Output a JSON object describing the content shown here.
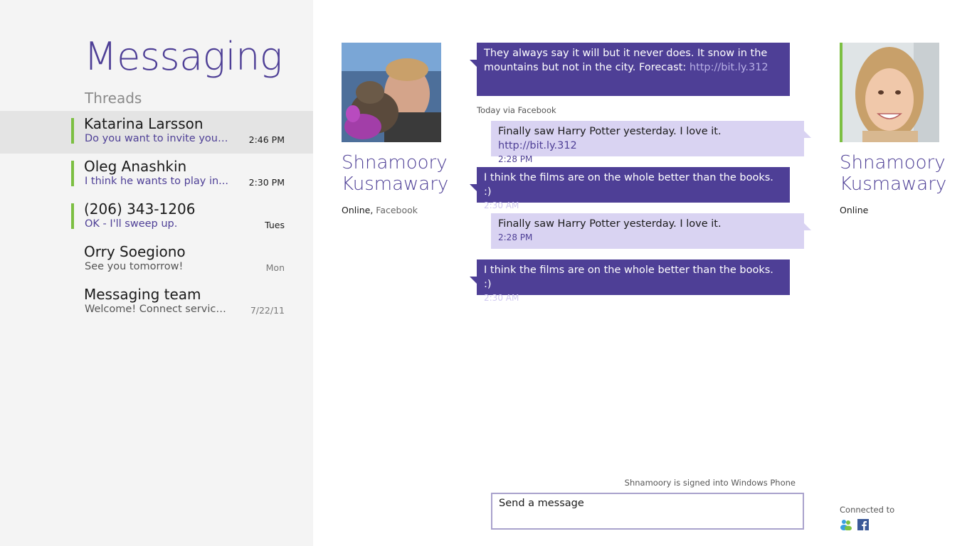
{
  "app": {
    "title": "Messaging",
    "threads_label": "Threads"
  },
  "threads": [
    {
      "name": "Katarina Larsson",
      "preview": "Do you want to invite your f...",
      "time": "2:46 PM"
    },
    {
      "name": "Oleg Anashkin",
      "preview": "I think he wants to play in...",
      "time": "2:30 PM"
    },
    {
      "name": "(206) 343-1206",
      "preview": "OK - I'll sweep up.",
      "time": "Tues"
    },
    {
      "name": "Orry Soegiono",
      "preview": "See you tomorrow!",
      "time": "Mon"
    },
    {
      "name": "Messaging team",
      "preview": "Welcome! Connect services...",
      "time": "7/22/11"
    }
  ],
  "contact_left": {
    "first": "Shnamoory",
    "last": "Kusmawary",
    "status": "Online,",
    "via": "Facebook"
  },
  "contact_right": {
    "first": "Shnamoory",
    "last": "Kusmawary",
    "status": "Online"
  },
  "messages": [
    {
      "text_line1": "They always say it will but it never does.  It snow in the",
      "text_line2": "mountains but not in the city. Forecast: ",
      "link": "http://bit.ly.312"
    },
    {
      "meta": "Today via Facebook"
    },
    {
      "text": "Finally saw Harry Potter yesterday. I love it. ",
      "link": "http://bit.ly.312",
      "time": "2:28 PM"
    },
    {
      "text": "I think the films are on the whole better than the books. :)",
      "time": "2:30 AM"
    },
    {
      "text": "Finally saw Harry Potter yesterday. I love it.",
      "time": "2:28 PM"
    },
    {
      "text": "I think the films are on the whole better than the books. :)",
      "time": "2:30 AM"
    }
  ],
  "composer": {
    "signed_in": "Shnamoory is signed into Windows Phone",
    "placeholder": "Send a message"
  },
  "connected": {
    "label": "Connected to",
    "services": [
      "messenger-icon",
      "facebook-icon"
    ]
  },
  "colors": {
    "accent": "#4e3f96",
    "bubble_out": "#d9d3f2",
    "presence": "#7cbf42",
    "pane": "#f4f4f4"
  }
}
